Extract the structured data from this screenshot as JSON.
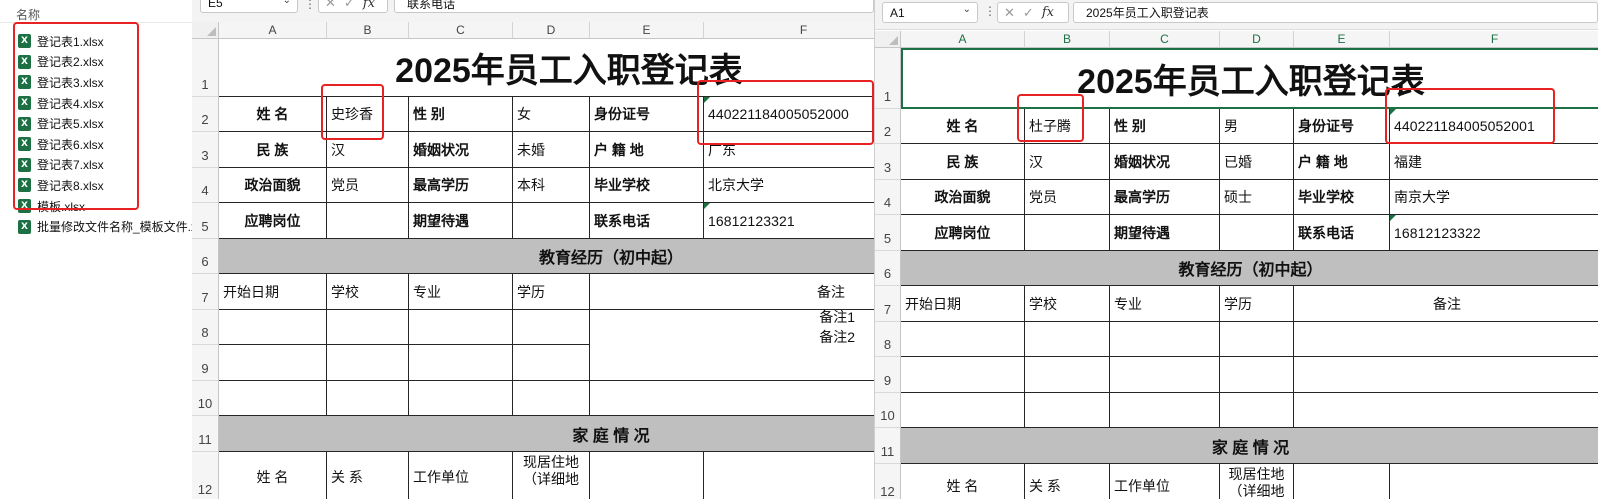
{
  "explorer": {
    "header": "名称",
    "files": [
      {
        "name": "登记表1.xlsx",
        "icon": "excel-file-icon"
      },
      {
        "name": "登记表2.xlsx",
        "icon": "excel-file-icon"
      },
      {
        "name": "登记表3.xlsx",
        "icon": "excel-file-icon"
      },
      {
        "name": "登记表4.xlsx",
        "icon": "excel-file-icon"
      },
      {
        "name": "登记表5.xlsx",
        "icon": "excel-file-icon"
      },
      {
        "name": "登记表6.xlsx",
        "icon": "excel-file-icon"
      },
      {
        "name": "登记表7.xlsx",
        "icon": "excel-file-icon"
      },
      {
        "name": "登记表8.xlsx",
        "icon": "excel-file-icon"
      },
      {
        "name": "模板.xlsx",
        "icon": "excel-file-icon"
      },
      {
        "name": "批量修改文件名称_模板文件.xlsx",
        "icon": "excel-file-icon"
      }
    ],
    "highlight_color": "#e82222"
  },
  "left_window": {
    "name_box": "E5",
    "formula": "联系电话",
    "columns": [
      "A",
      "B",
      "C",
      "D",
      "E",
      "F"
    ],
    "rows": [
      "1",
      "2",
      "3",
      "4",
      "5",
      "6",
      "7",
      "8",
      "9",
      "10",
      "11",
      "12"
    ],
    "form": {
      "title": "2025年员工入职登记表",
      "name_label": "姓 名",
      "name": "史珍香",
      "gender_label": "性 别",
      "gender": "女",
      "id_label": "身份证号",
      "id": "440221184005052000",
      "ethnicity_label": "民 族",
      "ethnicity": "汉",
      "marital_label": "婚姻状况",
      "marital": "未婚",
      "hometown_label": "户 籍 地",
      "hometown": "广东",
      "political_label": "政治面貌",
      "political": "党员",
      "degree_label": "最高学历",
      "degree": "本科",
      "school_label": "毕业学校",
      "school": "北京大学",
      "position_label": "应聘岗位",
      "position": "",
      "salary_label": "期望待遇",
      "salary": "",
      "phone_label": "联系电话",
      "phone": "16812123321",
      "education_header": "教育经历（初中起）",
      "edu_cols": [
        "开始日期",
        "学校",
        "专业",
        "学历",
        "备注"
      ],
      "notes": [
        "备注1",
        "备注2"
      ],
      "family_header": "家 庭 情 况",
      "family_cols": [
        "姓 名",
        "关 系",
        "工作单位",
        "现居住地（详细地"
      ]
    }
  },
  "right_window": {
    "name_box": "A1",
    "formula": "2025年员工入职登记表",
    "columns": [
      "A",
      "B",
      "C",
      "D",
      "E",
      "F"
    ],
    "rows": [
      "1",
      "2",
      "3",
      "4",
      "5",
      "6",
      "7",
      "8",
      "9",
      "10",
      "11",
      "12"
    ],
    "form": {
      "title": "2025年员工入职登记表",
      "name_label": "姓 名",
      "name": "杜子腾",
      "gender_label": "性 别",
      "gender": "男",
      "id_label": "身份证号",
      "id": "440221184005052001",
      "ethnicity_label": "民 族",
      "ethnicity": "汉",
      "marital_label": "婚姻状况",
      "marital": "已婚",
      "hometown_label": "户 籍 地",
      "hometown": "福建",
      "political_label": "政治面貌",
      "political": "党员",
      "degree_label": "最高学历",
      "degree": "硕士",
      "school_label": "毕业学校",
      "school": "南京大学",
      "position_label": "应聘岗位",
      "position": "",
      "salary_label": "期望待遇",
      "salary": "",
      "phone_label": "联系电话",
      "phone": "16812123322",
      "education_header": "教育经历（初中起）",
      "edu_cols": [
        "开始日期",
        "学校",
        "专业",
        "学历",
        "备注"
      ],
      "notes": [],
      "family_header": "家 庭 情 况",
      "family_cols": [
        "姓 名",
        "关 系",
        "工作单位",
        "现居住地（详细地"
      ]
    }
  }
}
